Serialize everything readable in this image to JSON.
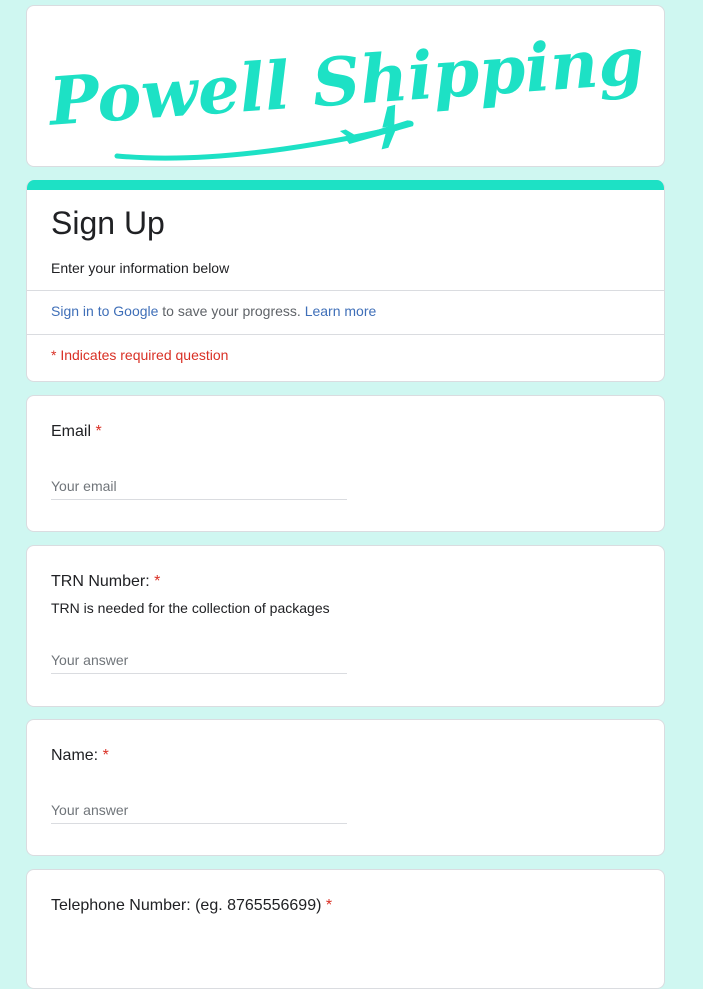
{
  "banner": {
    "logo_text": "Powell Shipping",
    "brand_color": "#1de1c5"
  },
  "form": {
    "title": "Sign Up",
    "description": "Enter your information below",
    "signin_link": "Sign in to Google",
    "signin_text": " to save your progress. ",
    "learn_more": "Learn more",
    "required_note": "* Indicates required question"
  },
  "questions": {
    "email": {
      "label": "Email",
      "required_mark": "*",
      "placeholder": "Your email"
    },
    "trn": {
      "label": "TRN Number:",
      "required_mark": "*",
      "help": "TRN is needed for the collection of packages",
      "placeholder": "Your answer"
    },
    "name": {
      "label": "Name:",
      "required_mark": "*",
      "placeholder": "Your answer"
    },
    "telephone": {
      "label": "Telephone Number: (eg. 8765556699)",
      "required_mark": "*"
    }
  },
  "colors": {
    "background": "#cff7f1",
    "accent": "#1de1c5",
    "required": "#d93025",
    "link": "#1a73e8"
  }
}
